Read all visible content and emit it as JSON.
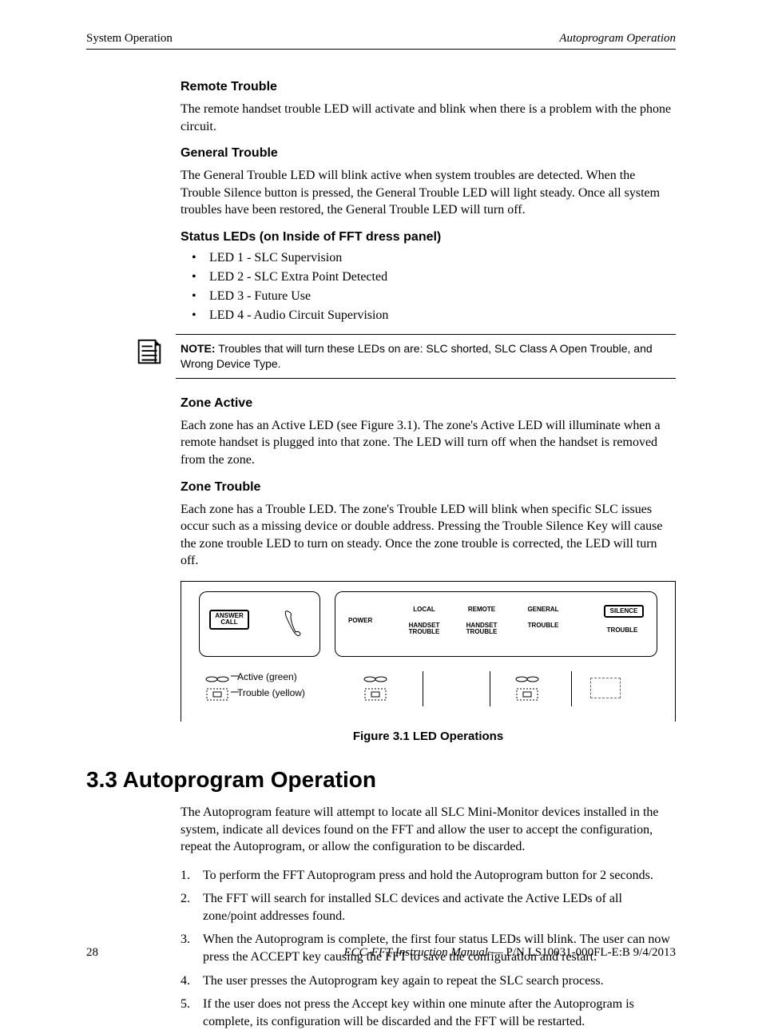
{
  "header": {
    "left": "System Operation",
    "right": "Autoprogram Operation"
  },
  "sec1": {
    "heading": "Remote Trouble",
    "para": "The remote handset trouble LED will activate and blink when there is a problem with the phone circuit."
  },
  "sec2": {
    "heading": "General Trouble",
    "para": "The General Trouble LED will blink active when system troubles are detected. When the Trouble Silence button is pressed, the General Trouble LED will light steady.  Once all system troubles have been restored, the General Trouble LED will turn off."
  },
  "sec3": {
    "heading": "Status LEDs (on Inside of FFT dress panel)",
    "items": [
      "LED 1 - SLC Supervision",
      "LED 2 - SLC Extra Point Detected",
      "LED 3 - Future Use",
      "LED 4 - Audio Circuit Supervision"
    ]
  },
  "note": {
    "label": "NOTE:",
    "text": "  Troubles that will turn these LEDs on are: SLC shorted, SLC Class A Open Trouble, and Wrong Device Type."
  },
  "sec4": {
    "heading": "Zone Active",
    "para": "Each zone has an Active LED (see Figure 3.1). The zone's Active LED will illuminate when a remote handset is plugged into that zone. The LED will turn off when the handset is removed from the zone."
  },
  "sec5": {
    "heading": "Zone Trouble",
    "para": "Each zone has a Trouble LED. The zone's Trouble LED will blink when specific SLC issues occur such as a missing device or double address. Pressing the Trouble Silence Key will cause the zone trouble LED to turn on steady.  Once the zone trouble is corrected, the LED will turn off."
  },
  "figure": {
    "answer_call": "ANSWER\nCALL",
    "power": "POWER",
    "local1": "LOCAL",
    "local2": "HANDSET\nTROUBLE",
    "remote1": "REMOTE",
    "remote2": "HANDSET\nTROUBLE",
    "general1": "GENERAL",
    "general2": "TROUBLE",
    "silence1": "SILENCE",
    "silence2": "TROUBLE",
    "active_label": "Active (green)",
    "trouble_label": "Trouble (yellow)",
    "caption": "Figure 3.1  LED Operations"
  },
  "autoprogram": {
    "heading": "3.3  Autoprogram Operation",
    "intro": "The Autoprogram feature will attempt to locate all SLC Mini-Monitor devices installed in the system, indicate all devices found on the FFT and allow the user to accept the configuration, repeat the Autoprogram, or allow the configuration to be discarded.",
    "steps": [
      "To perform the FFT Autoprogram press and hold the Autoprogram button for 2 seconds.",
      "The FFT will search for installed SLC devices and activate the Active LEDs of all zone/point addresses found.",
      "When the Autoprogram is complete, the first four status LEDs will blink. The user can now press the ACCEPT key causing the FFT to save the configuration and restart.",
      "The user presses the Autoprogram key again to repeat the SLC search process.",
      "If the user does not press the Accept key within one minute after the Autoprogram is complete, its configuration will be discarded and the FFT will be restarted."
    ]
  },
  "footer": {
    "page": "28",
    "right_italic": "ECC-FFT Instruction Manual",
    "right_rest": " — P/N LS10031-000FL-E:B  9/4/2013"
  }
}
